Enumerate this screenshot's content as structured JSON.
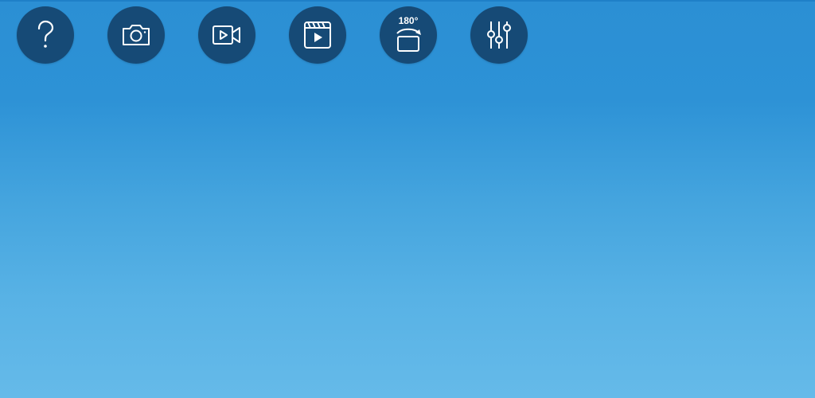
{
  "toolbar": {
    "buttons": [
      {
        "icon": "help-icon"
      },
      {
        "icon": "camera-icon"
      },
      {
        "icon": "video-record-icon"
      },
      {
        "icon": "video-library-icon"
      },
      {
        "icon": "rotate-180-icon",
        "label": "180°"
      },
      {
        "icon": "settings-sliders-icon"
      }
    ]
  },
  "colors": {
    "button_bg": "#164a76",
    "icon": "#ffffff",
    "background_top": "#2b8fd4",
    "background_bottom": "#65bae9"
  }
}
